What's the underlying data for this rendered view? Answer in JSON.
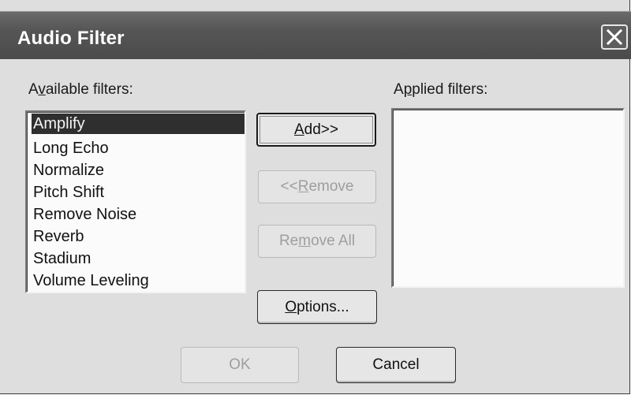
{
  "window": {
    "title": "Audio Filter"
  },
  "available": {
    "label_pre": "A",
    "label_access": "v",
    "label_post": "ailable filters:",
    "items": [
      "Amplify",
      "Long Echo",
      "Normalize",
      "Pitch Shift",
      "Remove Noise",
      "Reverb",
      "Stadium",
      "Volume Leveling"
    ],
    "selected": "Amplify"
  },
  "applied": {
    "label_pre": "A",
    "label_access": "p",
    "label_post": "plied filters:",
    "items": []
  },
  "buttons": {
    "add_access": "A",
    "add_post": "dd>>",
    "remove_pre": "<<",
    "remove_access": "R",
    "remove_post": "emove",
    "remove_all_pre": "Re",
    "remove_all_access": "m",
    "remove_all_post": "ove All",
    "options_access": "O",
    "options_post": "ptions...",
    "ok": "OK",
    "cancel": "Cancel"
  },
  "icons": {
    "close": "close-icon"
  },
  "colors": {
    "titlebar": "#555555",
    "selection": "#2f2f2f",
    "dialog_bg": "#dedede"
  }
}
